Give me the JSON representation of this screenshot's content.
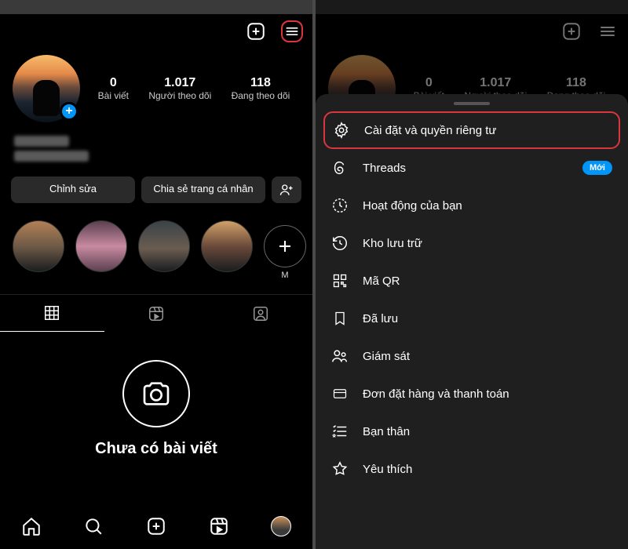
{
  "left": {
    "stats": {
      "posts": {
        "num": "0",
        "label": "Bài viết"
      },
      "followers": {
        "num": "1.017",
        "label": "Người theo dõi"
      },
      "following": {
        "num": "118",
        "label": "Đang theo dõi"
      }
    },
    "edit_label": "Chỉnh sửa",
    "share_label": "Chia sẻ trang cá nhân",
    "highlight_new_label": "M",
    "empty_text": "Chưa có bài viết"
  },
  "right": {
    "stats": {
      "posts": {
        "num": "0",
        "label": "Bài viết"
      },
      "followers": {
        "num": "1.017",
        "label": "Người theo dõi"
      },
      "following": {
        "num": "118",
        "label": "Đang theo dõi"
      }
    },
    "threads_badge": "Mới"
  },
  "menu": {
    "settings": "Cài đặt và quyền riêng tư",
    "threads": "Threads",
    "activity": "Hoạt động của bạn",
    "archive": "Kho lưu trữ",
    "qr": "Mã QR",
    "saved": "Đã lưu",
    "supervise": "Giám sát",
    "orders": "Đơn đặt hàng và thanh toán",
    "close": "Bạn thân",
    "favorites": "Yêu thích"
  },
  "icons": {
    "create": "plus-square",
    "menu": "hamburger",
    "add_people": "person-plus",
    "grid": "grid",
    "reels": "reels",
    "tagged": "person-frame",
    "camera": "camera",
    "home": "home",
    "search": "search",
    "settings": "gear",
    "threads": "at",
    "clock": "clock-arrow",
    "archive": "history",
    "qr": "qr",
    "bookmark": "bookmark",
    "people": "people",
    "card": "card",
    "list": "list-star",
    "star": "star"
  }
}
